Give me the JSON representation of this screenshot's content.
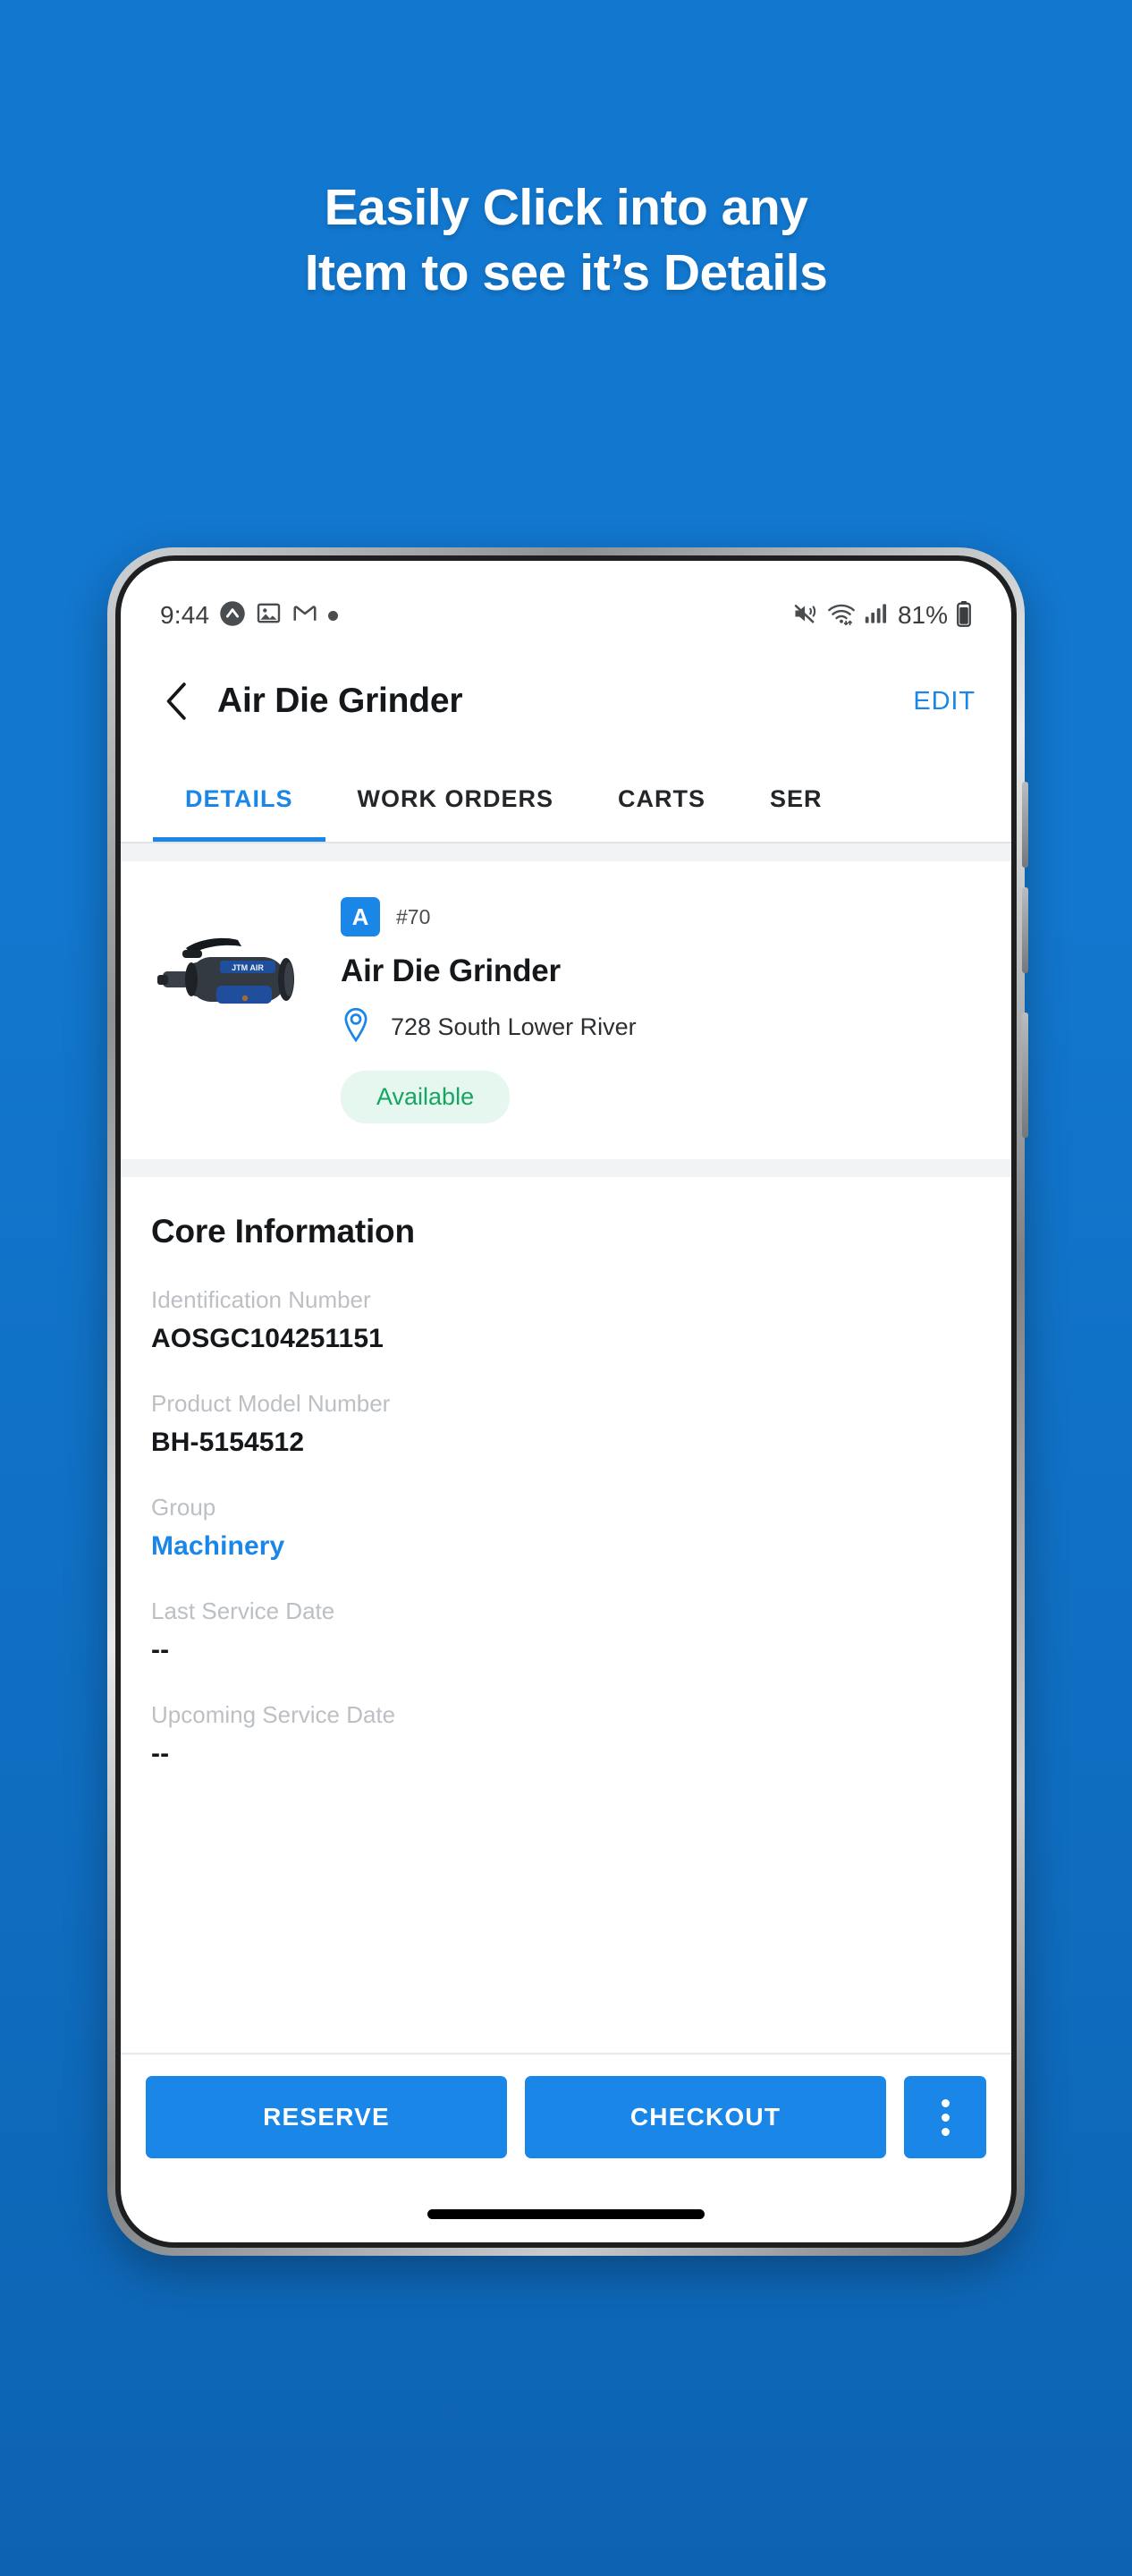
{
  "promo": {
    "line1": "Easily Click into any",
    "line2": "Item to see it’s Details",
    "background_color": "#1277ce",
    "text_color": "#ffffff"
  },
  "statusbar": {
    "time": "9:44",
    "battery_percent": "81%",
    "icons_left": [
      "opera-notification-icon",
      "image-notification-icon",
      "gmail-notification-icon",
      "more-notification-dot-icon"
    ],
    "icons_right": [
      "mute-icon",
      "wifi-icon",
      "cellular-signal-icon",
      "battery-icon"
    ]
  },
  "appbar": {
    "back_icon": "chevron-left-icon",
    "title": "Air Die Grinder",
    "edit_label": "EDIT",
    "accent_color": "#1a86e8"
  },
  "tabs": {
    "items": [
      {
        "label": "DETAILS",
        "active": true
      },
      {
        "label": "WORK ORDERS",
        "active": false
      },
      {
        "label": "CARTS",
        "active": false
      },
      {
        "label": "SER",
        "active": false
      }
    ]
  },
  "item_card": {
    "avatar_letter": "A",
    "number": "#70",
    "name": "Air Die Grinder",
    "location_icon": "location-pin-icon",
    "location": "728 South Lower River",
    "status": "Available",
    "status_color": "#16a563",
    "status_bg": "#e5f7ee",
    "thumbnail_alt": "air-die-grinder-photo"
  },
  "core_information": {
    "title": "Core Information",
    "fields": [
      {
        "label": "Identification Number",
        "value": "AOSGC104251151",
        "is_link": false
      },
      {
        "label": "Product Model Number",
        "value": "BH-5154512",
        "is_link": false
      },
      {
        "label": "Group",
        "value": "Machinery",
        "is_link": true
      },
      {
        "label": "Last Service Date",
        "value": "--",
        "is_link": false
      },
      {
        "label": "Upcoming Service Date",
        "value": "--",
        "is_link": false
      }
    ]
  },
  "action_bar": {
    "reserve_label": "RESERVE",
    "checkout_label": "CHECKOUT",
    "more_icon": "overflow-menu-vertical-icon"
  }
}
